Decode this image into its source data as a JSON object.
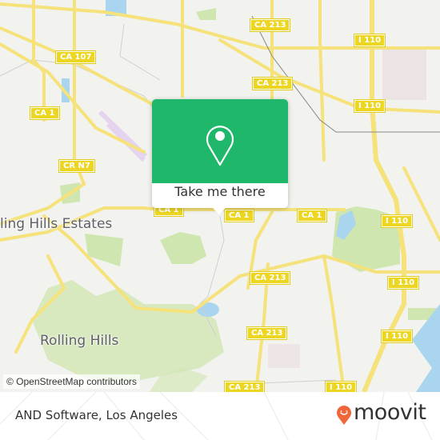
{
  "map": {
    "attribution": "© OpenStreetMap contributors",
    "places": [
      {
        "id": "rolling-hills-estates",
        "label": "ling Hills Estates"
      },
      {
        "id": "rolling-hills",
        "label": "Rolling Hills"
      }
    ],
    "road_shields": [
      {
        "id": "ca-213-a",
        "label": "CA 213"
      },
      {
        "id": "ca-107",
        "label": "CA 107"
      },
      {
        "id": "ca-213-b",
        "label": "CA 213"
      },
      {
        "id": "i-110-a",
        "label": "I 110"
      },
      {
        "id": "ca-1-a",
        "label": "CA 1"
      },
      {
        "id": "i-110-b",
        "label": "I 110"
      },
      {
        "id": "cr-n7",
        "label": "CR N7"
      },
      {
        "id": "ca-1-b",
        "label": "CA 1"
      },
      {
        "id": "ca-1-c",
        "label": "CA 1"
      },
      {
        "id": "ca-1-d",
        "label": "CA 1"
      },
      {
        "id": "i-110-c",
        "label": "I 110"
      },
      {
        "id": "ca-213-c",
        "label": "CA 213"
      },
      {
        "id": "i-110-d",
        "label": "I 110"
      },
      {
        "id": "ca-213-d",
        "label": "CA 213"
      },
      {
        "id": "i-110-e",
        "label": "I 110"
      },
      {
        "id": "ca-213-e",
        "label": "CA 213"
      },
      {
        "id": "i-110-f",
        "label": "I 110"
      }
    ],
    "colors": {
      "background": "#f2f2ee",
      "road": "#f6e27a",
      "park": "#cfe6b0",
      "water": "#a9d5ee",
      "accent": "#1fb86a"
    }
  },
  "popup": {
    "icon": "map-pin-icon",
    "action_label": "Take me there"
  },
  "footer": {
    "title": "AND Software, Los Angeles",
    "brand": "moovit",
    "brand_color": "#f0663a"
  }
}
